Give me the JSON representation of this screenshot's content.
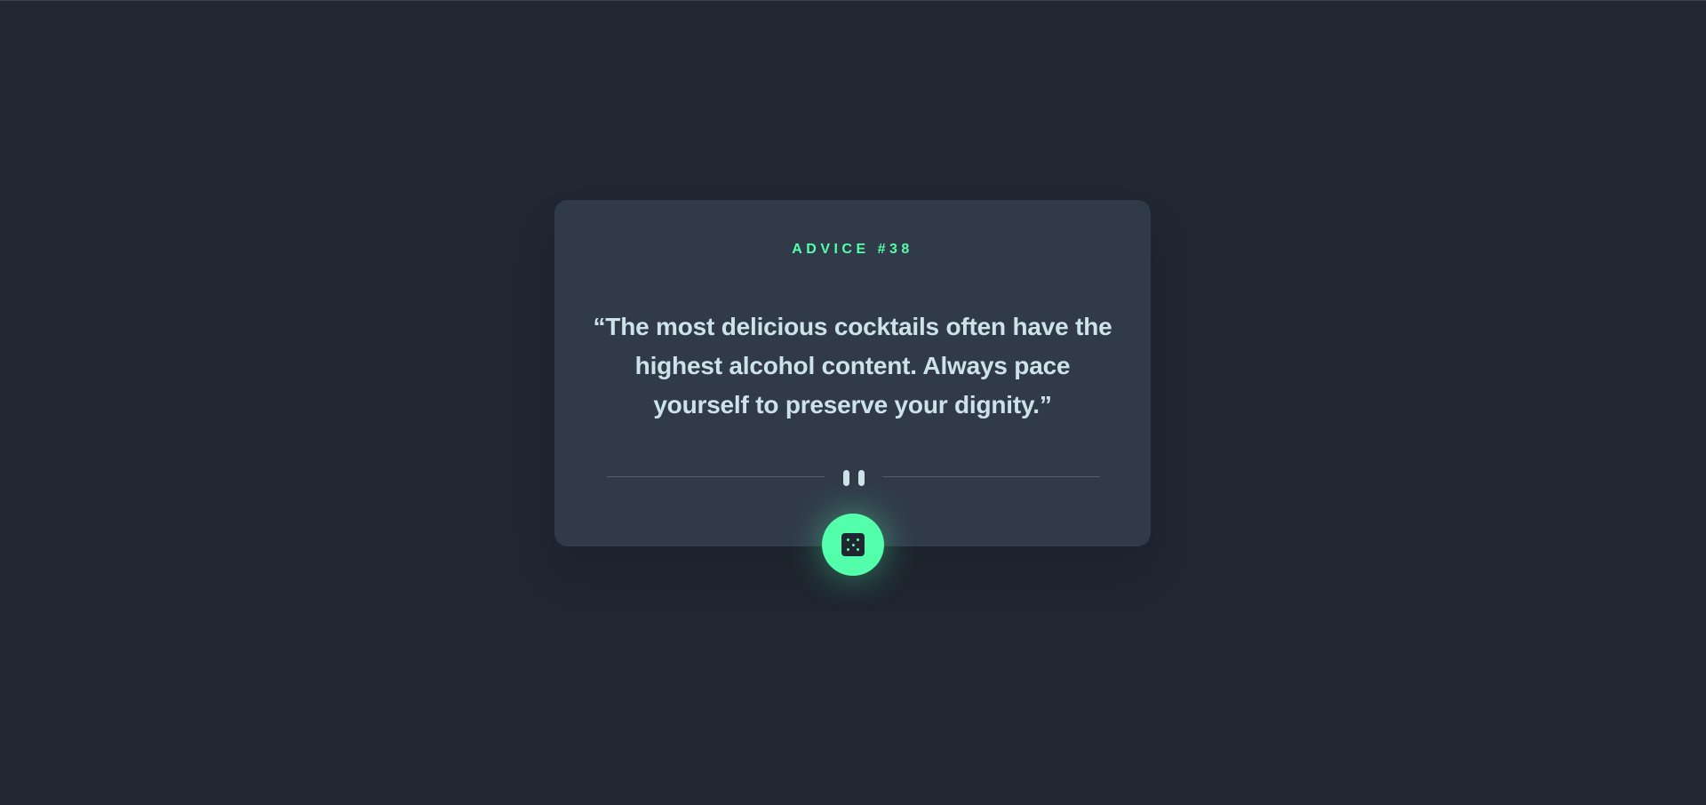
{
  "card": {
    "advice_id": "ADVICE #38",
    "advice_text": "“The most delicious cocktails often have the highest alcohol content. Always pace yourself to preserve your dignity.”"
  },
  "divider": {
    "icon": "pause-icon"
  },
  "dice_button": {
    "icon": "dice-icon"
  },
  "colors": {
    "background": "#202632",
    "card": "#313a49",
    "accent": "#53ffaa",
    "text": "#cee3e9",
    "divider": "#4f5d74"
  }
}
